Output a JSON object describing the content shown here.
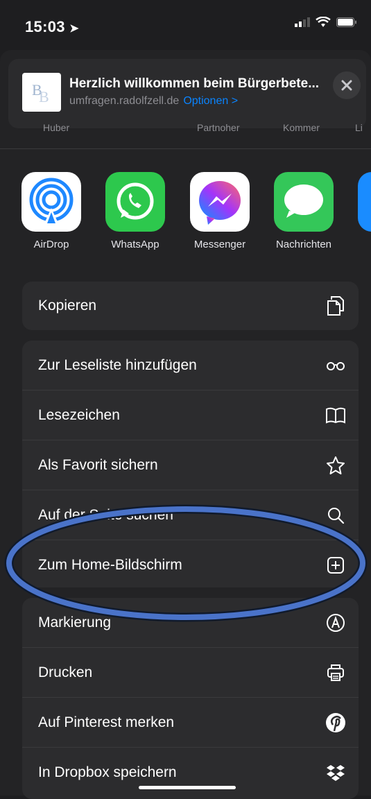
{
  "status": {
    "time": "15:03"
  },
  "header": {
    "title": "Herzlich willkommen beim Bürgerbete...",
    "url": "umfragen.radolfzell.de",
    "options_label": "Optionen >",
    "logo_text": "BB"
  },
  "contacts": [
    "Huber",
    "Partnoher",
    "Kommer",
    "Li"
  ],
  "apps": [
    {
      "label": "AirDrop",
      "icon": "airdrop-icon"
    },
    {
      "label": "WhatsApp",
      "icon": "whatsapp-icon"
    },
    {
      "label": "Messenger",
      "icon": "messenger-icon"
    },
    {
      "label": "Nachrichten",
      "icon": "messages-icon"
    }
  ],
  "actions": {
    "copy": {
      "label": "Kopieren",
      "icon": "copy-icon"
    },
    "group2": [
      {
        "label": "Zur Leseliste hinzufügen",
        "icon": "glasses-icon"
      },
      {
        "label": "Lesezeichen",
        "icon": "book-icon"
      },
      {
        "label": "Als Favorit sichern",
        "icon": "star-icon"
      },
      {
        "label": "Auf der Seite suchen",
        "icon": "search-icon"
      },
      {
        "label": "Zum Home-Bildschirm",
        "icon": "add-square-icon"
      }
    ],
    "group3": [
      {
        "label": "Markierung",
        "icon": "markup-icon"
      },
      {
        "label": "Drucken",
        "icon": "printer-icon"
      },
      {
        "label": "Auf Pinterest merken",
        "icon": "pinterest-icon"
      },
      {
        "label": "In Dropbox speichern",
        "icon": "dropbox-icon"
      }
    ]
  },
  "colors": {
    "accent": "#0a84ff",
    "annotation": "#4a73c9"
  }
}
